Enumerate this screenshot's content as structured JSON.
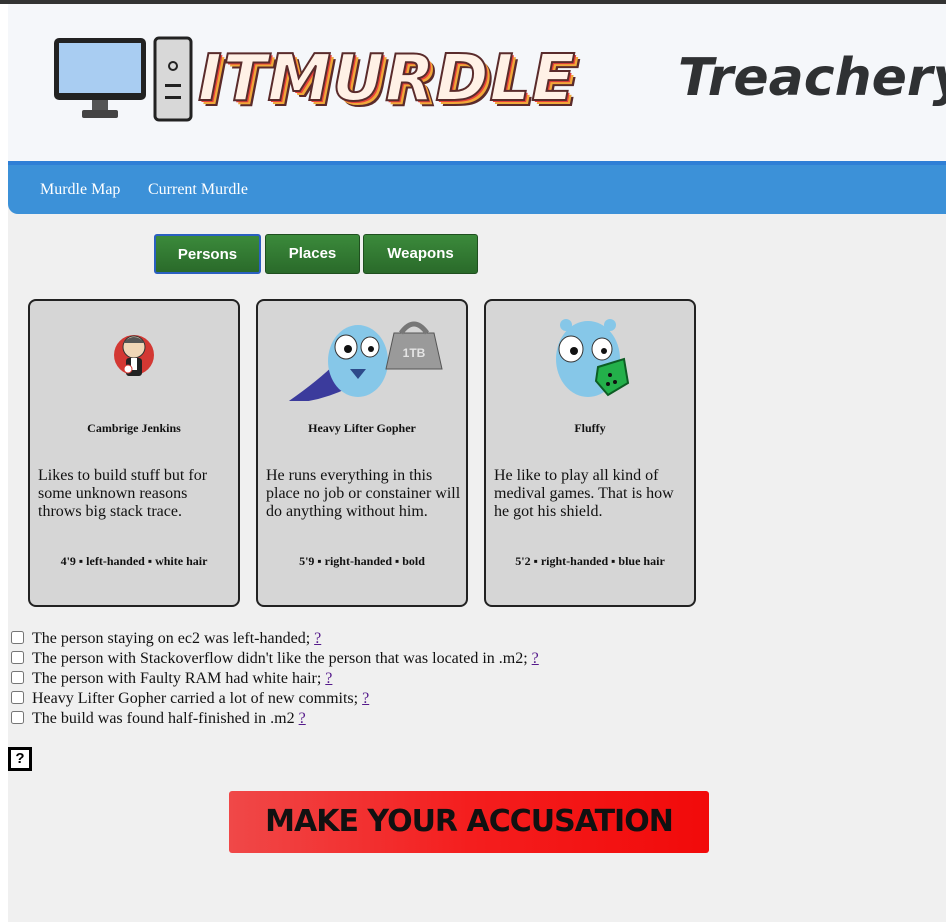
{
  "header": {
    "logo_text": "ITMURDLE",
    "tagline": "Treachery ir"
  },
  "nav": {
    "items": [
      {
        "label": "Murdle Map"
      },
      {
        "label": "Current Murdle"
      }
    ]
  },
  "tabs": [
    {
      "label": "Persons",
      "active": true
    },
    {
      "label": "Places",
      "active": false
    },
    {
      "label": "Weapons",
      "active": false
    }
  ],
  "cards": [
    {
      "name": "Cambrige Jenkins",
      "description": "Likes to build stuff but for some unknown reasons throws big stack trace.",
      "traits": "4'9 ▪ left-handed ▪ white hair",
      "icon": "jenkins-butler-icon"
    },
    {
      "name": "Heavy Lifter Gopher",
      "description": "He runs everything in this place no job or constainer will do anything without him.",
      "traits": "5'9 ▪ right-handed ▪ bold",
      "icon": "gopher-weight-icon",
      "weight_label": "1TB"
    },
    {
      "name": "Fluffy",
      "description": "He like to play all kind of medival games. That is how he got his shield.",
      "traits": "5'2 ▪ right-handed ▪ blue hair",
      "icon": "gopher-shield-icon"
    }
  ],
  "clues": [
    {
      "text": "The person staying on ec2 was left-handed;",
      "link": "?"
    },
    {
      "text": "The person with Stackoverflow didn't like the person that was located in .m2;",
      "link": "?"
    },
    {
      "text": "The person with Faulty RAM had white hair;",
      "link": "?"
    },
    {
      "text": "Heavy Lifter Gopher carried a lot of new commits;",
      "link": "?"
    },
    {
      "text": "The build was found half-finished in .m2",
      "link": "?"
    }
  ],
  "help_button": "?",
  "accuse_button": "MAKE YOUR ACCUSATION",
  "colors": {
    "navbar": "#3c91d8",
    "tab_green": "#2f7a2f",
    "accuse_red": "#f41e1e",
    "card_bg": "#d6d6d6"
  }
}
